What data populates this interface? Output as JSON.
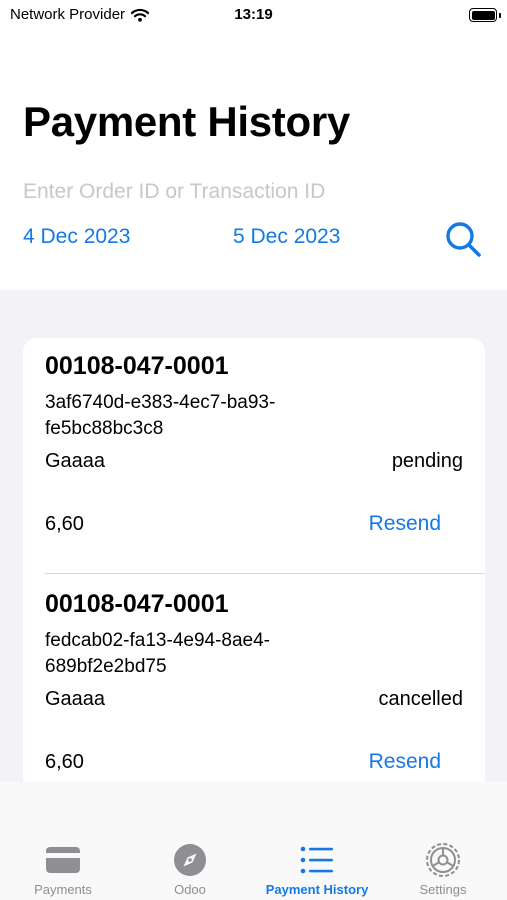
{
  "status_bar": {
    "carrier": "Network Provider",
    "time": "13:19"
  },
  "header": {
    "title": "Payment History",
    "search_placeholder": "Enter Order ID or Transaction ID",
    "start_date": "4 Dec 2023",
    "end_date": "5 Dec 2023"
  },
  "transactions": [
    {
      "order_id": "00108-047-0001",
      "transaction_id": "3af6740d-e383-4ec7-ba93-fe5bc88bc3c8",
      "customer": "Gaaaa",
      "status": "pending",
      "amount": "6,60",
      "action_label": "Resend"
    },
    {
      "order_id": "00108-047-0001",
      "transaction_id": "fedcab02-fa13-4e94-8ae4-689bf2e2bd75",
      "customer": "Gaaaa",
      "status": "cancelled",
      "amount": "6,60",
      "action_label": "Resend"
    }
  ],
  "tab_bar": {
    "active": "Payment History",
    "tabs": [
      {
        "label": "Payments",
        "icon": "credit-card-icon"
      },
      {
        "label": "Odoo",
        "icon": "compass-icon"
      },
      {
        "label": "Payment History",
        "icon": "list-icon"
      },
      {
        "label": "Settings",
        "icon": "gear-icon"
      }
    ]
  },
  "colors": {
    "accent": "#1479e6",
    "inactive": "#8e8e93",
    "list_background": "#f2f2f7",
    "placeholder": "#c7c7cc"
  }
}
